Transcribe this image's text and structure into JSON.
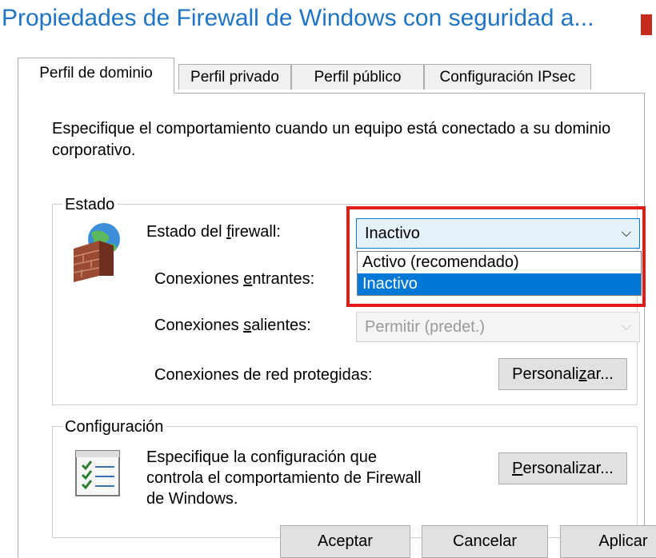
{
  "window": {
    "title": "Propiedades de Firewall de Windows con seguridad a..."
  },
  "tabs": [
    {
      "label": "Perfil de dominio",
      "active": true
    },
    {
      "label": "Perfil privado",
      "active": false
    },
    {
      "label": "Perfil público",
      "active": false
    },
    {
      "label": "Configuración IPsec",
      "active": false
    }
  ],
  "description": "Especifique el comportamiento cuando un equipo está conectado a su dominio corporativo.",
  "estado": {
    "group_label": "Estado",
    "firewall_state": {
      "label_pre": "Estado del ",
      "label_accel": "f",
      "label_post": "irewall:",
      "value": "Inactivo",
      "options": [
        "Activo (recomendado)",
        "Inactivo"
      ],
      "selected_option": "Inactivo"
    },
    "inbound": {
      "label_pre": "Conexiones ",
      "label_accel": "e",
      "label_post": "ntrantes:"
    },
    "outbound": {
      "label_pre": "Conexiones ",
      "label_accel": "s",
      "label_post": "alientes:",
      "value": "Permitir (predet.)"
    },
    "protected": {
      "label": "Conexiones de red protegidas:",
      "button_pre": "Personali",
      "button_accel": "z",
      "button_post": "ar..."
    }
  },
  "configuracion": {
    "group_label": "Configuración",
    "text_line1": "Especifique la configuración que",
    "text_line2": "controla el comportamiento de Firewall",
    "text_line3": "de Windows.",
    "button_accel": "P",
    "button_post": "ersonalizar..."
  },
  "footer": {
    "ok": "Aceptar",
    "cancel": "Cancelar",
    "apply": "Aplicar"
  },
  "colors": {
    "title": "#1f74c6",
    "highlight": "#0078d7",
    "annotation_red": "#e21b1b"
  }
}
